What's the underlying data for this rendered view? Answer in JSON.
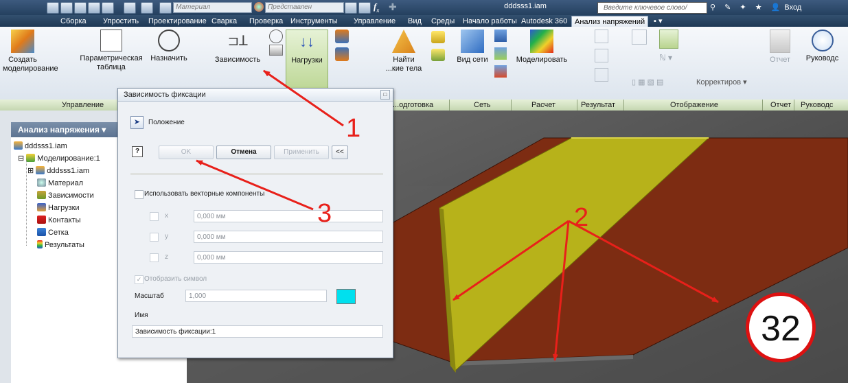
{
  "qat": {
    "material_placeholder": "Материал",
    "appearance_placeholder": "Представлен"
  },
  "document_title": "dddsss1.iam",
  "search_placeholder": "Введите ключевое слово/фразу",
  "signin": "Вход",
  "tabs": [
    "Сборка",
    "Упростить",
    "Проектирование",
    "Сварка",
    "Проверка",
    "Инструменты",
    "Управление",
    "Вид",
    "Среды",
    "Начало работы",
    "Autodesk 360",
    "Анализ напряжений"
  ],
  "ribbon": {
    "create_sim": "Создать",
    "create_sim2": "моделирование",
    "param_table": "Параметрическая",
    "param_table2": "таблица",
    "assign": "Назначить",
    "constraints": "Зависимость",
    "loads": "Нагрузки",
    "find": "Найти",
    "find2": "...кие тела",
    "mesh_view": "Вид сети",
    "simulate": "Моделировать",
    "report": "Отчет",
    "guide": "Руководс",
    "adjust": "Корректиров"
  },
  "panels": [
    "Управление",
    "...одготовка",
    "Сеть",
    "Расчет",
    "Результат",
    "Отображение",
    "Отчет",
    "Руководс"
  ],
  "browser": {
    "header": "Анализ напряжения",
    "items": [
      "dddsss1.iam",
      "Моделирование:1",
      "dddsss1.iam",
      "Материал",
      "Зависимости",
      "Нагрузки",
      "Контакты",
      "Сетка",
      "Результаты"
    ]
  },
  "dialog": {
    "title": "Зависимость фиксации",
    "position_label": "Положение",
    "ok": "OK",
    "cancel": "Отмена",
    "apply": "Применить",
    "collapse": "<<",
    "vector_components": "Использовать векторные компоненты",
    "x_label": "x",
    "y_label": "y",
    "z_label": "z",
    "x_value": "0,000 мм",
    "y_value": "0,000 мм",
    "z_value": "0,000 мм",
    "show_symbol": "Отобразить символ",
    "scale_label": "Масштаб",
    "scale_value": "1,000",
    "name_label": "Имя",
    "name_value": "Зависимость фиксации:1",
    "color_swatch": "#00e0ee"
  },
  "annotations": {
    "n1": "1",
    "n2": "2",
    "n3": "3",
    "badge": "32"
  },
  "colors": {
    "arrow": "#e8201a",
    "plate_yellow": "#b7b21a",
    "plate_brown": "#7d2c12"
  }
}
